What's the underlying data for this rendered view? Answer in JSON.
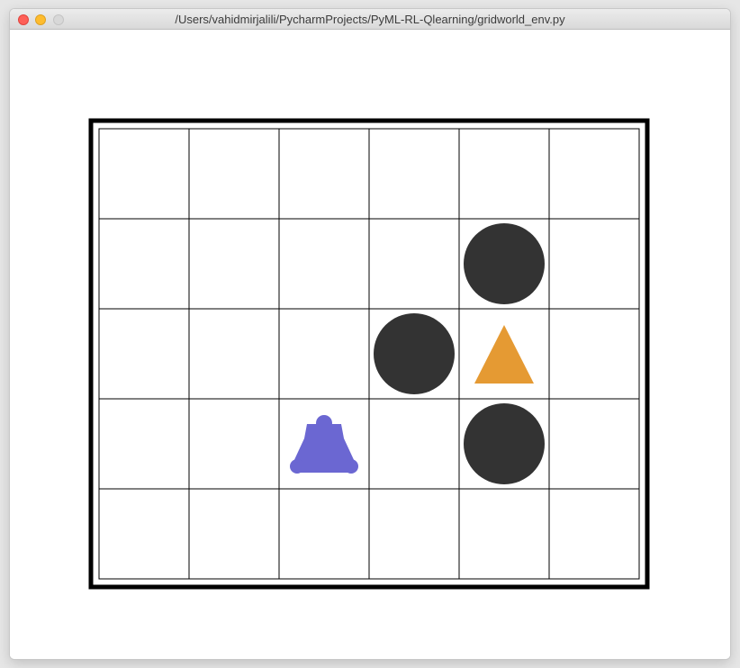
{
  "window": {
    "title": "/Users/vahidmirjalili/PycharmProjects/PyML-RL-Qlearning/gridworld_env.py",
    "buttons": [
      "close",
      "minimize",
      "zoom"
    ]
  },
  "grid": {
    "rows": 5,
    "cols": 6,
    "colors": {
      "background": "#ffffff",
      "grid_line": "#000000",
      "border": "#000000",
      "hole": "#333333",
      "goal": "#e59a33",
      "agent": "#6b67d2"
    },
    "holes": [
      {
        "row": 1,
        "col": 4
      },
      {
        "row": 2,
        "col": 3
      },
      {
        "row": 3,
        "col": 4
      }
    ],
    "goal": {
      "row": 2,
      "col": 4,
      "icon": "triangle-icon"
    },
    "agent": {
      "row": 3,
      "col": 2,
      "icon": "bell-icon"
    }
  }
}
